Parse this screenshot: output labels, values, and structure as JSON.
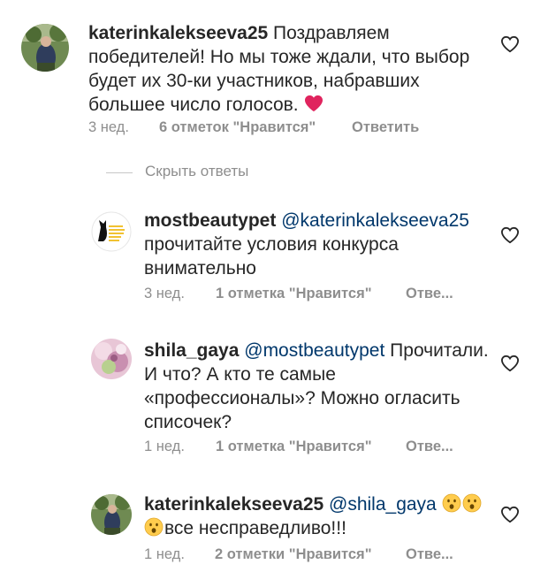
{
  "comments": [
    {
      "username": "katerinkalekseeva25",
      "text": "Поздравляем победителей! Но мы тоже ждали, что выбор будет их 30-ки участников,  набравших большее число голосов.",
      "time": "3 нед.",
      "likes": "6 отметок \"Нравится\"",
      "reply": "Ответить"
    },
    {
      "username": "mostbeautypet",
      "mention": "@katerinkalekseeva25",
      "text": "прочитайте условия конкурса внимательно",
      "time": "3 нед.",
      "likes": "1 отметка \"Нравится\"",
      "reply": "Отве..."
    },
    {
      "username": "shila_gaya",
      "mention": "@mostbeautypet",
      "text": "Прочитали. И что? А кто те самые «профессионалы»? Можно огласить списочек?",
      "time": "1 нед.",
      "likes": "1 отметка \"Нравится\"",
      "reply": "Отве..."
    },
    {
      "username": "katerinkalekseeva25",
      "mention": "@shila_gaya",
      "text": "все несправедливо!!!",
      "time": "1 нед.",
      "likes": "2 отметки \"Нравится\"",
      "reply": "Отве..."
    }
  ],
  "hide_replies": "Скрыть ответы",
  "icons": {
    "like": "heart-outline-icon",
    "heart_emoji": "red-heart-emoji",
    "face_emoji": "hushed-face-emoji"
  },
  "colors": {
    "text": "#262626",
    "meta": "#8e8e8e",
    "mention": "#00376b",
    "heart_emoji": "#e0245e"
  }
}
